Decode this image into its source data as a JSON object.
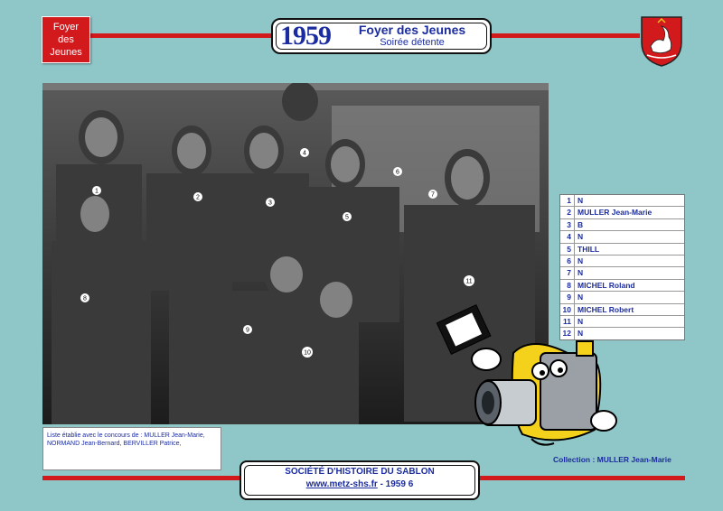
{
  "badge": {
    "line1": "Foyer",
    "line2": "des",
    "line3": "Jeunes"
  },
  "header": {
    "year": "1959",
    "title": "Foyer des Jeunes",
    "subtitle": "Soirée détente"
  },
  "photo_markers": [
    "1",
    "2",
    "3",
    "4",
    "5",
    "6",
    "7",
    "8",
    "9",
    "10",
    "11"
  ],
  "people": [
    {
      "num": "1",
      "name": "N"
    },
    {
      "num": "2",
      "name": "MULLER Jean-Marie"
    },
    {
      "num": "3",
      "name": "B"
    },
    {
      "num": "4",
      "name": "N"
    },
    {
      "num": "5",
      "name": "THILL"
    },
    {
      "num": "6",
      "name": "N"
    },
    {
      "num": "7",
      "name": "N"
    },
    {
      "num": "8",
      "name": "MICHEL Roland"
    },
    {
      "num": "9",
      "name": "N"
    },
    {
      "num": "10",
      "name": "MICHEL Robert"
    },
    {
      "num": "11",
      "name": "N"
    },
    {
      "num": "12",
      "name": "N"
    }
  ],
  "credits": {
    "line1": "Liste établie avec le concours de :   MULLER Jean-Marie,",
    "line2": "NORMAND Jean-Bernard, BERVILLER Patrice,"
  },
  "collection": "Collection : MULLER Jean-Marie",
  "footer": {
    "society": "SOCIÉTÉ D'HISTOIRE DU SABLON",
    "url": "www.metz-shs.fr",
    "ref": " - 1959 6"
  },
  "colors": {
    "background": "#8fc6c8",
    "accent_red": "#d2191c",
    "text_blue": "#1b2ca0"
  }
}
